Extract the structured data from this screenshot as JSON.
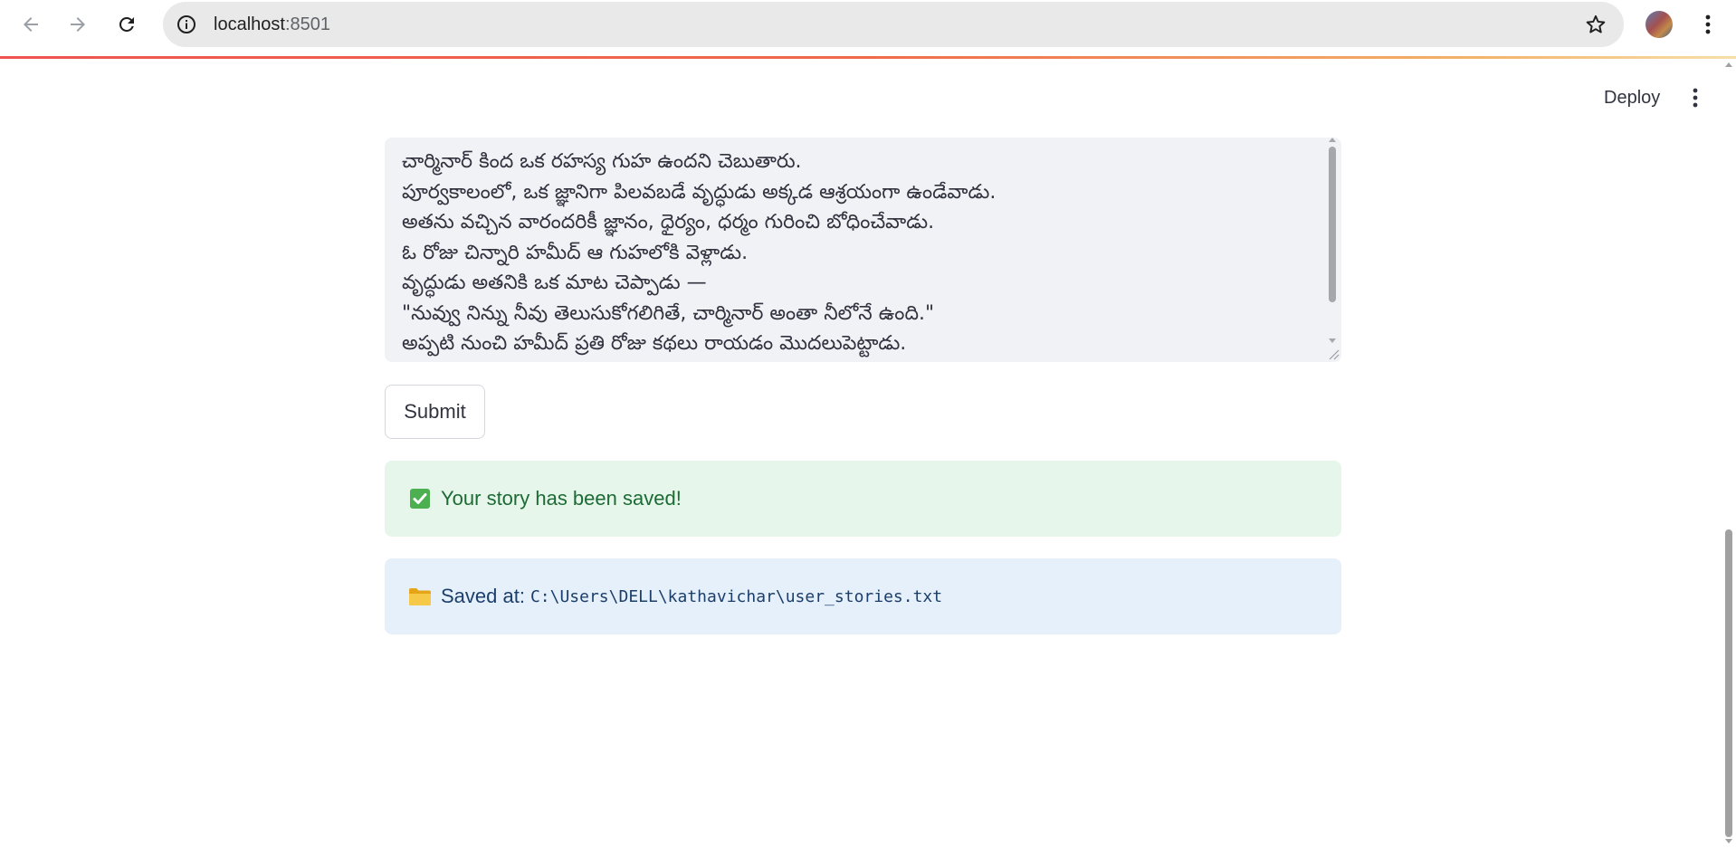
{
  "browser": {
    "url_host": "localhost",
    "url_port": ":8501",
    "icons": {
      "back": "arrow-left-icon",
      "forward": "arrow-right-icon",
      "reload": "reload-icon",
      "site_info": "info-icon",
      "bookmark": "star-icon",
      "profile": "avatar",
      "menu": "kebab-menu-icon"
    }
  },
  "header": {
    "deploy_label": "Deploy",
    "menu_icon": "kebab-menu-icon"
  },
  "story": {
    "text": "చార్మినార్ కింద ఒక రహస్య గుహ ఉందని చెబుతారు.\nపూర్వకాలంలో, ఒక జ్ఞానిగా పిలవబడే వృద్ధుడు అక్కడ ఆశ్రయంగా ఉండేవాడు.\nఅతను వచ్చిన వారందరికీ జ్ఞానం, ధైర్యం, ధర్మం గురించి బోధించేవాడు.\nఓ రోజు చిన్నారి హమీద్ ఆ గుహలోకి వెళ్లాడు.\nవృద్ధుడు అతనికి ఒక మాట చెప్పాడు —\n\"నువ్వు నిన్ను నీవు తెలుసుకోగలిగితే, చార్మినార్ అంతా నీలోనే ఉంది.\"\nఅప్పటి నుంచి హమీద్ ప్రతి రోజు కథలు రాయడం మొదలుపెట్టాడు."
  },
  "actions": {
    "submit_label": "Submit"
  },
  "alerts": {
    "success": {
      "icon": "check-mark-button-icon",
      "text": "Your story has been saved!"
    },
    "info": {
      "icon": "folder-icon",
      "label": "Saved at:",
      "path": "C:\\Users\\DELL\\kathavichar\\user_stories.txt"
    }
  },
  "colors": {
    "success_bg": "#e6f6ea",
    "success_text": "#1c6b35",
    "info_bg": "#e6f0fa",
    "info_text": "#1b3e6b",
    "textarea_bg": "#f0f2f6"
  }
}
